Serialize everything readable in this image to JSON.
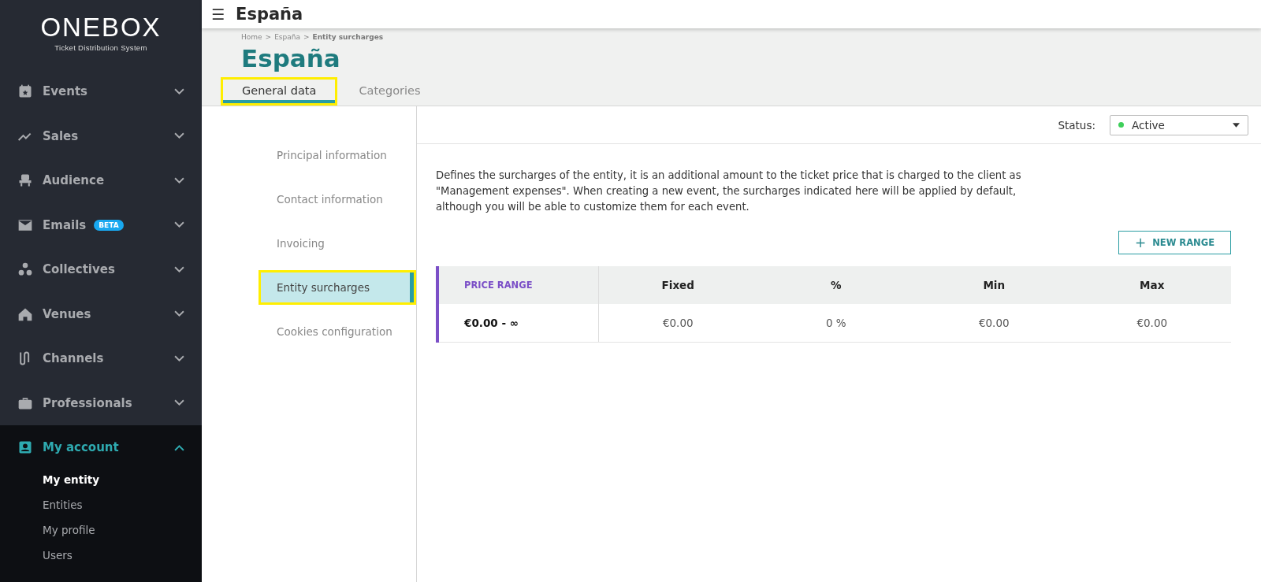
{
  "sidebar": {
    "logo": "ONEBOX",
    "tagline": "Ticket Distribution System",
    "items": [
      {
        "label": "Events",
        "kind": "calendar",
        "expanded": false,
        "selected": false
      },
      {
        "label": "Sales",
        "kind": "trend",
        "expanded": false,
        "selected": false
      },
      {
        "label": "Audience",
        "kind": "seat",
        "expanded": false,
        "selected": false
      },
      {
        "label": "Emails",
        "kind": "mail",
        "badge": "BETA",
        "expanded": false,
        "selected": false
      },
      {
        "label": "Collectives",
        "kind": "dots",
        "expanded": false,
        "selected": false
      },
      {
        "label": "Venues",
        "kind": "house",
        "expanded": false,
        "selected": false
      },
      {
        "label": "Channels",
        "kind": "channels",
        "expanded": false,
        "selected": false
      },
      {
        "label": "Professionals",
        "kind": "briefcase",
        "expanded": false,
        "selected": false
      },
      {
        "label": "My account",
        "kind": "account",
        "expanded": true,
        "selected": true,
        "children": [
          {
            "label": "My entity",
            "selected": true
          },
          {
            "label": "Entities",
            "selected": false
          },
          {
            "label": "My profile",
            "selected": false
          },
          {
            "label": "Users",
            "selected": false
          }
        ]
      }
    ]
  },
  "topbar": {
    "menu_glyph": "☰",
    "title": "España"
  },
  "header": {
    "breadcrumb": [
      {
        "label": "Home",
        "current": false
      },
      {
        "label": "España",
        "current": false
      },
      {
        "label": "Entity surcharges",
        "current": true
      }
    ],
    "separator": ">",
    "title": "España",
    "tabs": [
      {
        "label": "General data",
        "selected": true,
        "highlighted": true
      },
      {
        "label": "Categories",
        "selected": false,
        "highlighted": false
      }
    ]
  },
  "subnav": [
    {
      "label": "Principal information",
      "selected": false,
      "highlighted": false
    },
    {
      "label": "Contact information",
      "selected": false,
      "highlighted": false
    },
    {
      "label": "Invoicing",
      "selected": false,
      "highlighted": false
    },
    {
      "label": "Entity surcharges",
      "selected": true,
      "highlighted": true
    },
    {
      "label": "Cookies configuration",
      "selected": false,
      "highlighted": false
    }
  ],
  "status": {
    "label": "Status:",
    "value": "Active",
    "color": "#3ecf5a"
  },
  "description": "Defines the surcharges of the entity, it is an additional amount to the ticket price that is charged to the client as \"Management expenses\". When creating a new event, the surcharges indicated here will be applied by default, although you will be able to customize them for each event.",
  "new_range_button": {
    "icon_glyph": "+",
    "label": "NEW RANGE"
  },
  "table": {
    "columns": [
      "PRICE RANGE",
      "Fixed",
      "%",
      "Min",
      "Max"
    ],
    "rows": [
      [
        "€0.00 - ∞",
        "€0.00",
        "0 %",
        "€0.00",
        "€0.00"
      ]
    ]
  }
}
